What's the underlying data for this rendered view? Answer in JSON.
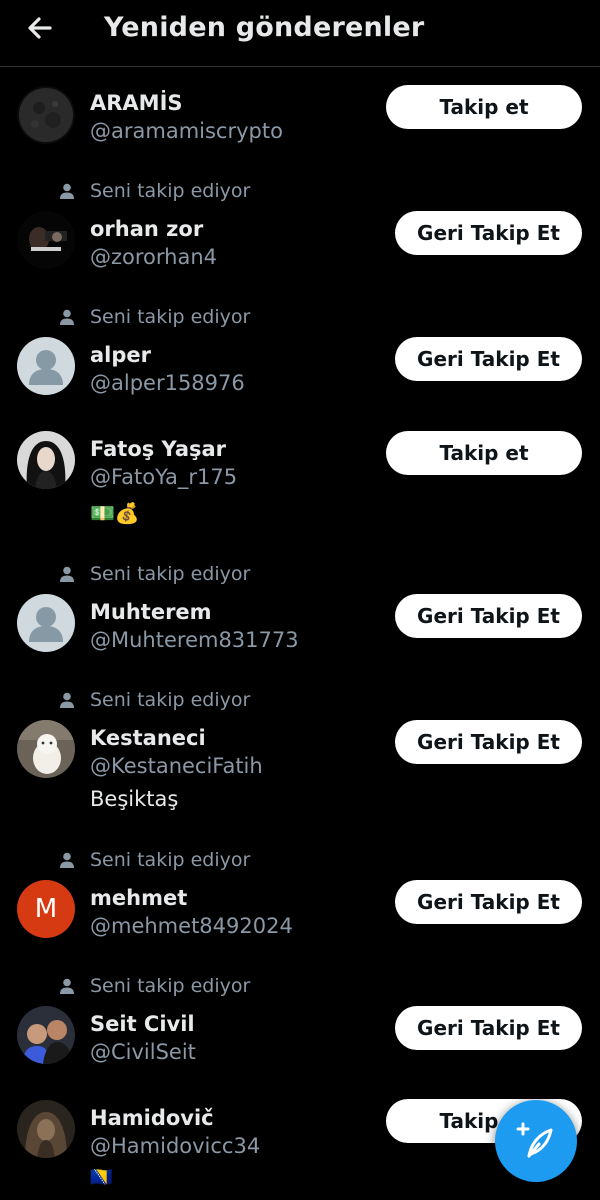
{
  "header": {
    "title": "Yeniden gönderenler",
    "back_icon": "arrow-left-icon"
  },
  "colors": {
    "background": "#000000",
    "primary_text": "#e7e9ea",
    "secondary_text": "#8b98a5",
    "button_bg": "#ffffff",
    "fab_bg": "#1d9bf0"
  },
  "context_label": "Seni takip ediyor",
  "users": [
    {
      "name": "ARAMİS",
      "handle": "@aramamiscrypto",
      "follows_you": false,
      "button": "Takip et",
      "bio": ""
    },
    {
      "name": "orhan zor",
      "handle": "@zororhan4",
      "follows_you": true,
      "button": "Geri Takip Et",
      "bio": ""
    },
    {
      "name": "alper",
      "handle": "@alper158976",
      "follows_you": true,
      "button": "Geri Takip Et",
      "bio": ""
    },
    {
      "name": "Fatoş Yaşar",
      "handle": "@FatoYa_r175",
      "follows_you": false,
      "button": "Takip et",
      "bio": "💵💰"
    },
    {
      "name": "Muhterem",
      "handle": "@Muhterem831773",
      "follows_you": true,
      "button": "Geri Takip Et",
      "bio": ""
    },
    {
      "name": "Kestaneci",
      "handle": "@KestaneciFatih",
      "follows_you": true,
      "button": "Geri Takip Et",
      "bio": "Beşiktaş"
    },
    {
      "name": "mehmet",
      "handle": "@mehmet8492024",
      "follows_you": true,
      "button": "Geri Takip Et",
      "bio": "",
      "avatar_letter": "M",
      "avatar_color": "#d53a12"
    },
    {
      "name": "Seit Civil",
      "handle": "@CivilSeit",
      "follows_you": true,
      "button": "Geri Takip Et",
      "bio": ""
    },
    {
      "name": "Hamidovič",
      "handle": "@Hamidovicc34",
      "follows_you": false,
      "button": "Takip et",
      "bio": "🇧🇦"
    }
  ],
  "fab": {
    "icon": "compose-post-icon"
  }
}
